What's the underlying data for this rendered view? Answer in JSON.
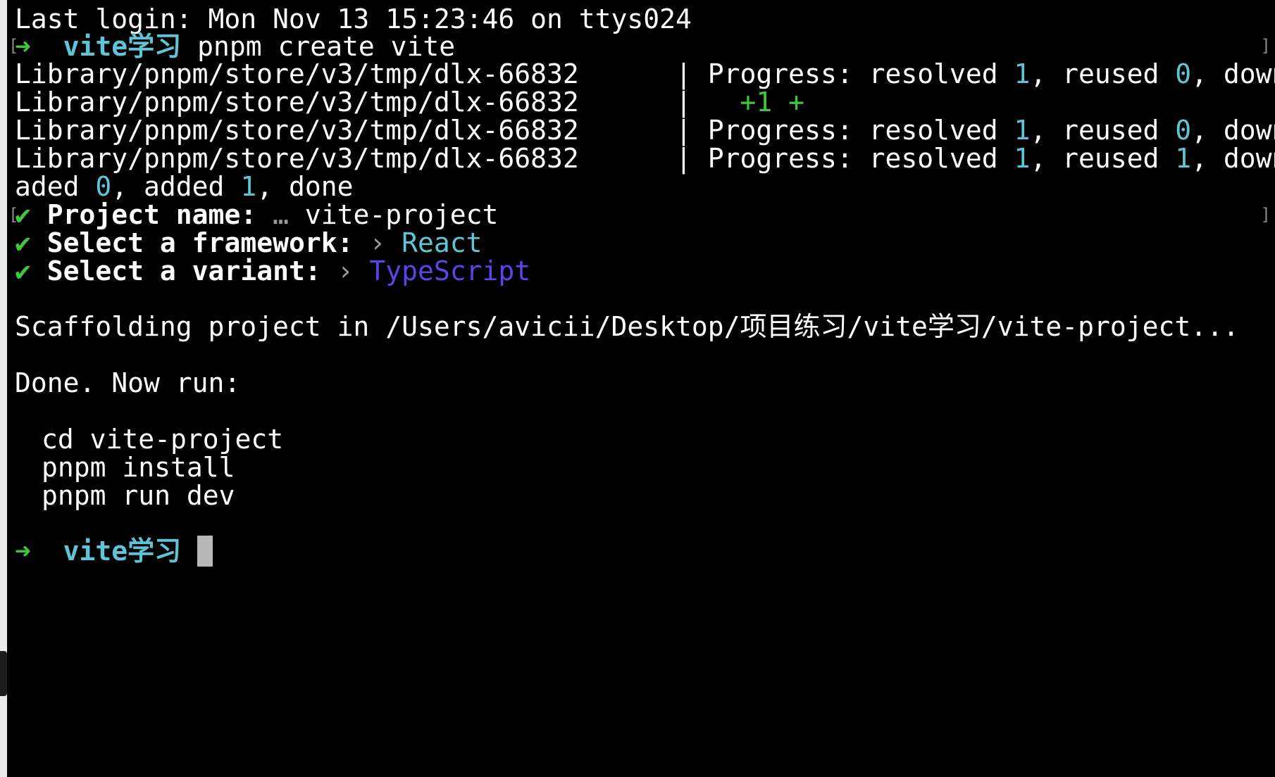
{
  "login_line": "Last login: Mon Nov 13 15:23:46 on ttys024",
  "prompt": {
    "arrow": "➜",
    "dir": "vite学习",
    "command": "pnpm create vite"
  },
  "progress": {
    "path": "Library/pnpm/store/v3/tmp/dlx-66832",
    "sep": "|",
    "row1": {
      "label": "Progress: resolved ",
      "resolved": "1",
      "mid": ", reused ",
      "reused": "0",
      "tail": ", downlo"
    },
    "row2": {
      "added_text": "  +1 +"
    },
    "row3": {
      "label": "Progress: resolved ",
      "resolved": "1",
      "mid": ", reused ",
      "reused": "0",
      "tail": ", downlo"
    },
    "row4": {
      "label": "Progress: resolved ",
      "resolved": "1",
      "mid": ", reused ",
      "reused": "1",
      "tail": ", downlo"
    },
    "wrap": {
      "prefix": "aded ",
      "downloaded": "0",
      "mid": ", added ",
      "added": "1",
      "tail": ", done"
    }
  },
  "questions": [
    {
      "check": "✔",
      "label": "Project name:",
      "sep": "…",
      "answer": "vite-project"
    },
    {
      "check": "✔",
      "label": "Select a framework:",
      "sep": "›",
      "answer": "React"
    },
    {
      "check": "✔",
      "label": "Select a variant:",
      "sep": "›",
      "answer": "TypeScript"
    }
  ],
  "scaffolding": "Scaffolding project in /Users/avicii/Desktop/项目练习/vite学习/vite-project...",
  "done": "Done. Now run:",
  "next_steps": [
    "cd vite-project",
    "pnpm install",
    "pnpm run dev"
  ],
  "final_prompt": {
    "arrow": "➜",
    "dir": "vite学习"
  },
  "colors": {
    "background": "#000000",
    "arrow_green": "#3fc63c",
    "dir_cyan": "#5fc4d6",
    "react_cyan": "#5fc4d6",
    "typescript_purple": "#5a45e6",
    "number_cyan": "#5fc4d6",
    "cursor": "#b8b8b8"
  }
}
